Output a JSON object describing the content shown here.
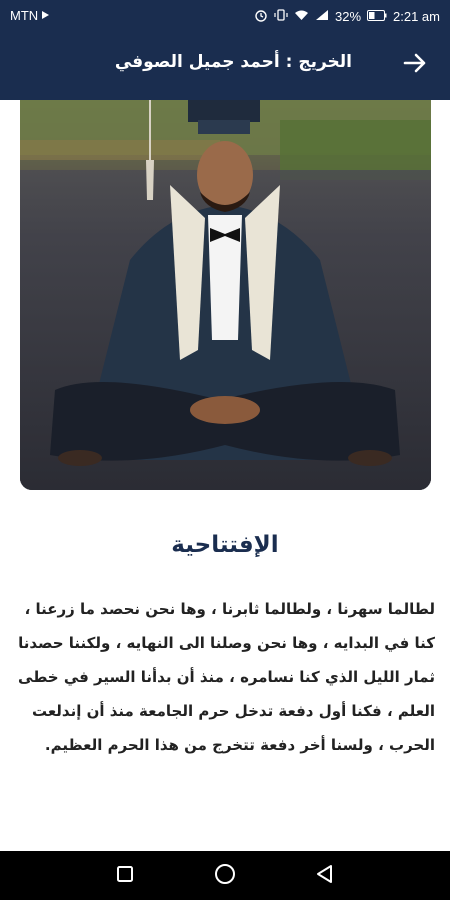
{
  "status_bar": {
    "carrier": "MTN",
    "battery": "32%",
    "time": "2:21 am",
    "icons": [
      "alarm-icon",
      "vibrate-icon",
      "wifi-icon",
      "signal-icon",
      "battery-icon"
    ]
  },
  "header": {
    "title": "الخريج : أحمد جميل الصوفي",
    "back_icon": "arrow-right-icon"
  },
  "article": {
    "photo": "graduate-portrait-photo",
    "title": "الإفتتاحية",
    "body": "لطالما سهرنا ، ولطالما ثابرنا ، وها نحن نحصد ما زرعنا ، كنا في البدايه ، وها نحن وصلنا الى النهايه ، ولكننا حصدنا ثمار الليل الذي كنا نسامره ، منذ أن بدأنا السير في خطى العلم ، فكنا أول دفعة تدخل حرم الجامعة منذ أن إندلعت الحرب ، ولسنا أخر دفعة تتخرج من هذا الحرم العظيم."
  },
  "nav": {
    "icons": [
      "recents-square-icon",
      "home-circle-icon",
      "back-triangle-icon"
    ]
  },
  "colors": {
    "header_bg": "#1a2d4f",
    "title_color": "#1a2d4f",
    "text_color": "#222222"
  }
}
